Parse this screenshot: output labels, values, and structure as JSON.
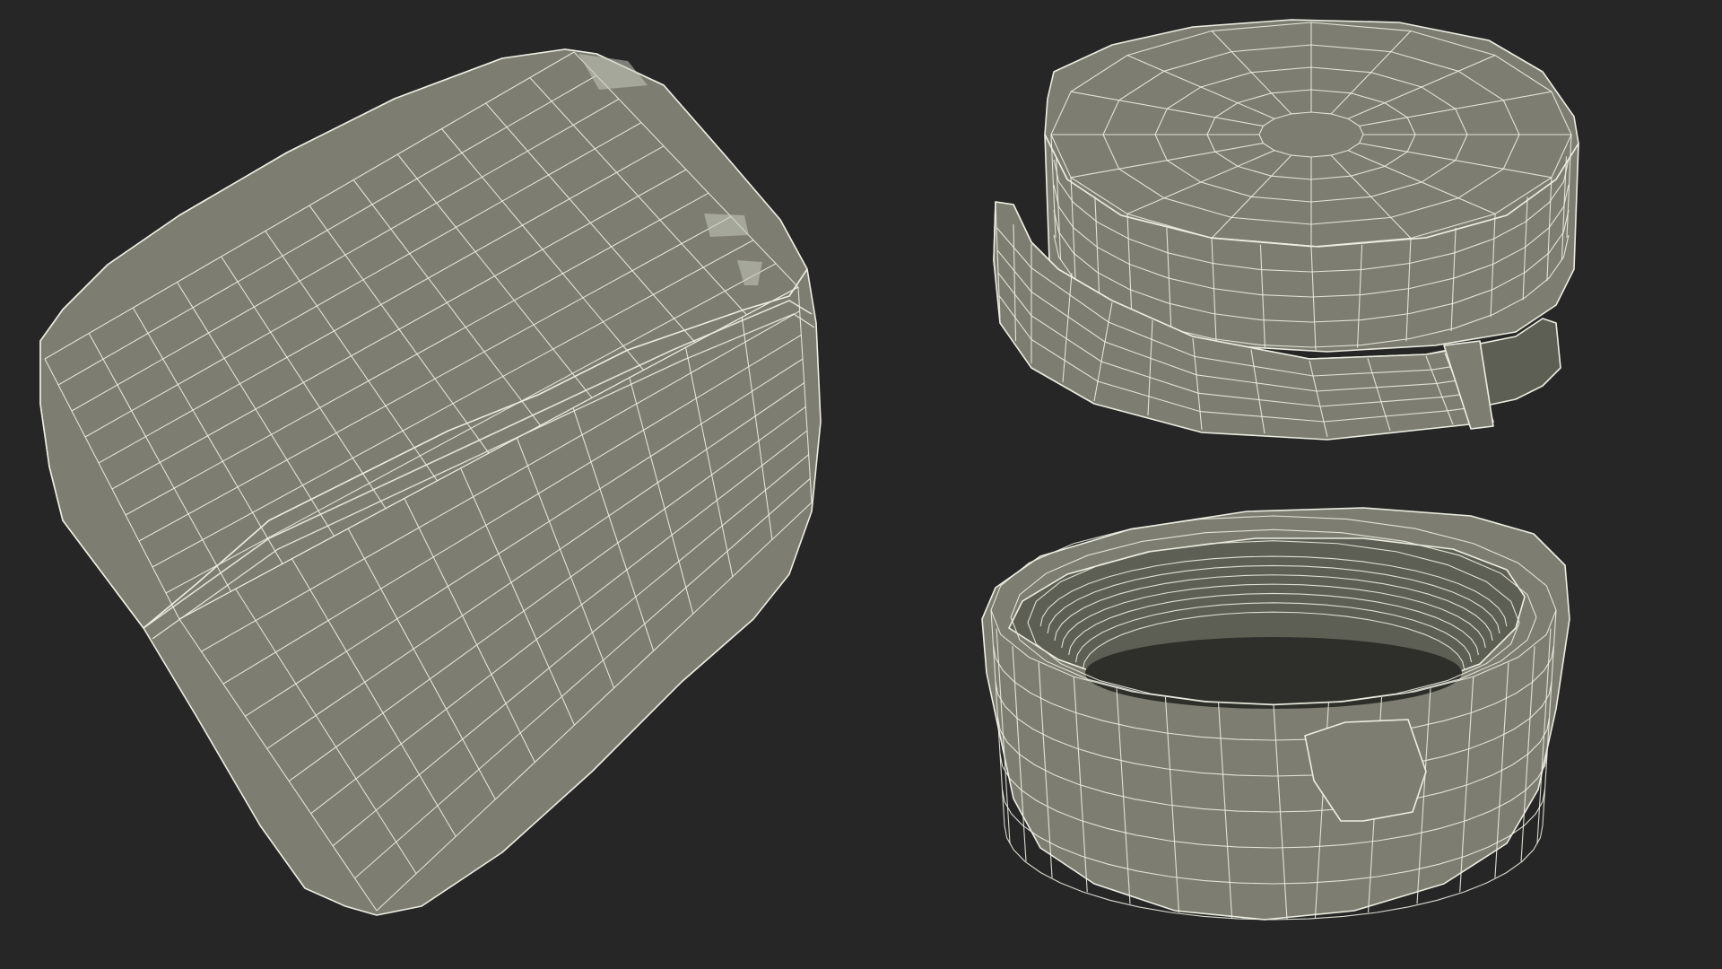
{
  "scene": {
    "background_color": "#262626",
    "surface_color": "#7d7e71",
    "surface_dark_color": "#5e5f54",
    "inner_shadow_color": "#2e2f2a",
    "wire_color": "#eceee2",
    "highlight_color": "#c7c9bd",
    "objects": [
      {
        "name": "wireframe-body-cap",
        "kind": "rounded-box"
      },
      {
        "name": "wireframe-lid",
        "kind": "cylinder-lid-with-band"
      },
      {
        "name": "wireframe-base-cup",
        "kind": "open-cylinder-cup"
      }
    ]
  }
}
